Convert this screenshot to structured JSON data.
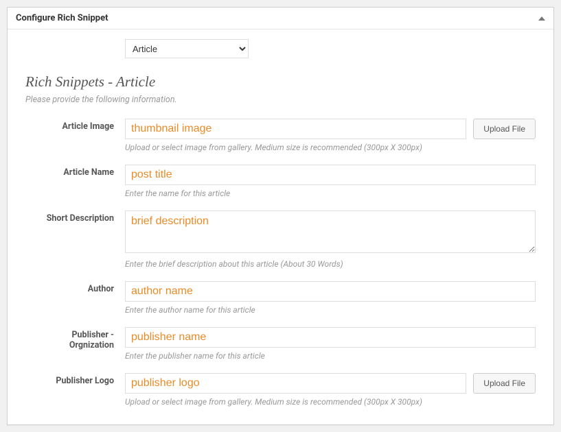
{
  "panel": {
    "title": "Configure Rich Snippet"
  },
  "typeSelect": {
    "value": "Article"
  },
  "section": {
    "title": "Rich Snippets - Article",
    "subtitle": "Please provide the following information."
  },
  "fields": {
    "articleImage": {
      "label": "Article Image",
      "placeholder": "thumbnail image",
      "uploadLabel": "Upload File",
      "hint": "Upload or select image from gallery. Medium size is recommended (300px X 300px)"
    },
    "articleName": {
      "label": "Article Name",
      "placeholder": "post title",
      "hint": "Enter the name for this article"
    },
    "shortDescription": {
      "label": "Short Description",
      "placeholder": "brief description",
      "hint": "Enter the brief description about this article (About 30 Words)"
    },
    "author": {
      "label": "Author",
      "placeholder": "author name",
      "hint": "Enter the author name for this article"
    },
    "publisherOrg": {
      "label": "Publisher - Orgnization",
      "placeholder": "publisher name",
      "hint": "Enter the publisher name for this article"
    },
    "publisherLogo": {
      "label": "Publisher Logo",
      "placeholder": "publisher logo",
      "uploadLabel": "Upload File",
      "hint": "Upload or select image from gallery. Medium size is recommended (300px X 300px)"
    }
  }
}
